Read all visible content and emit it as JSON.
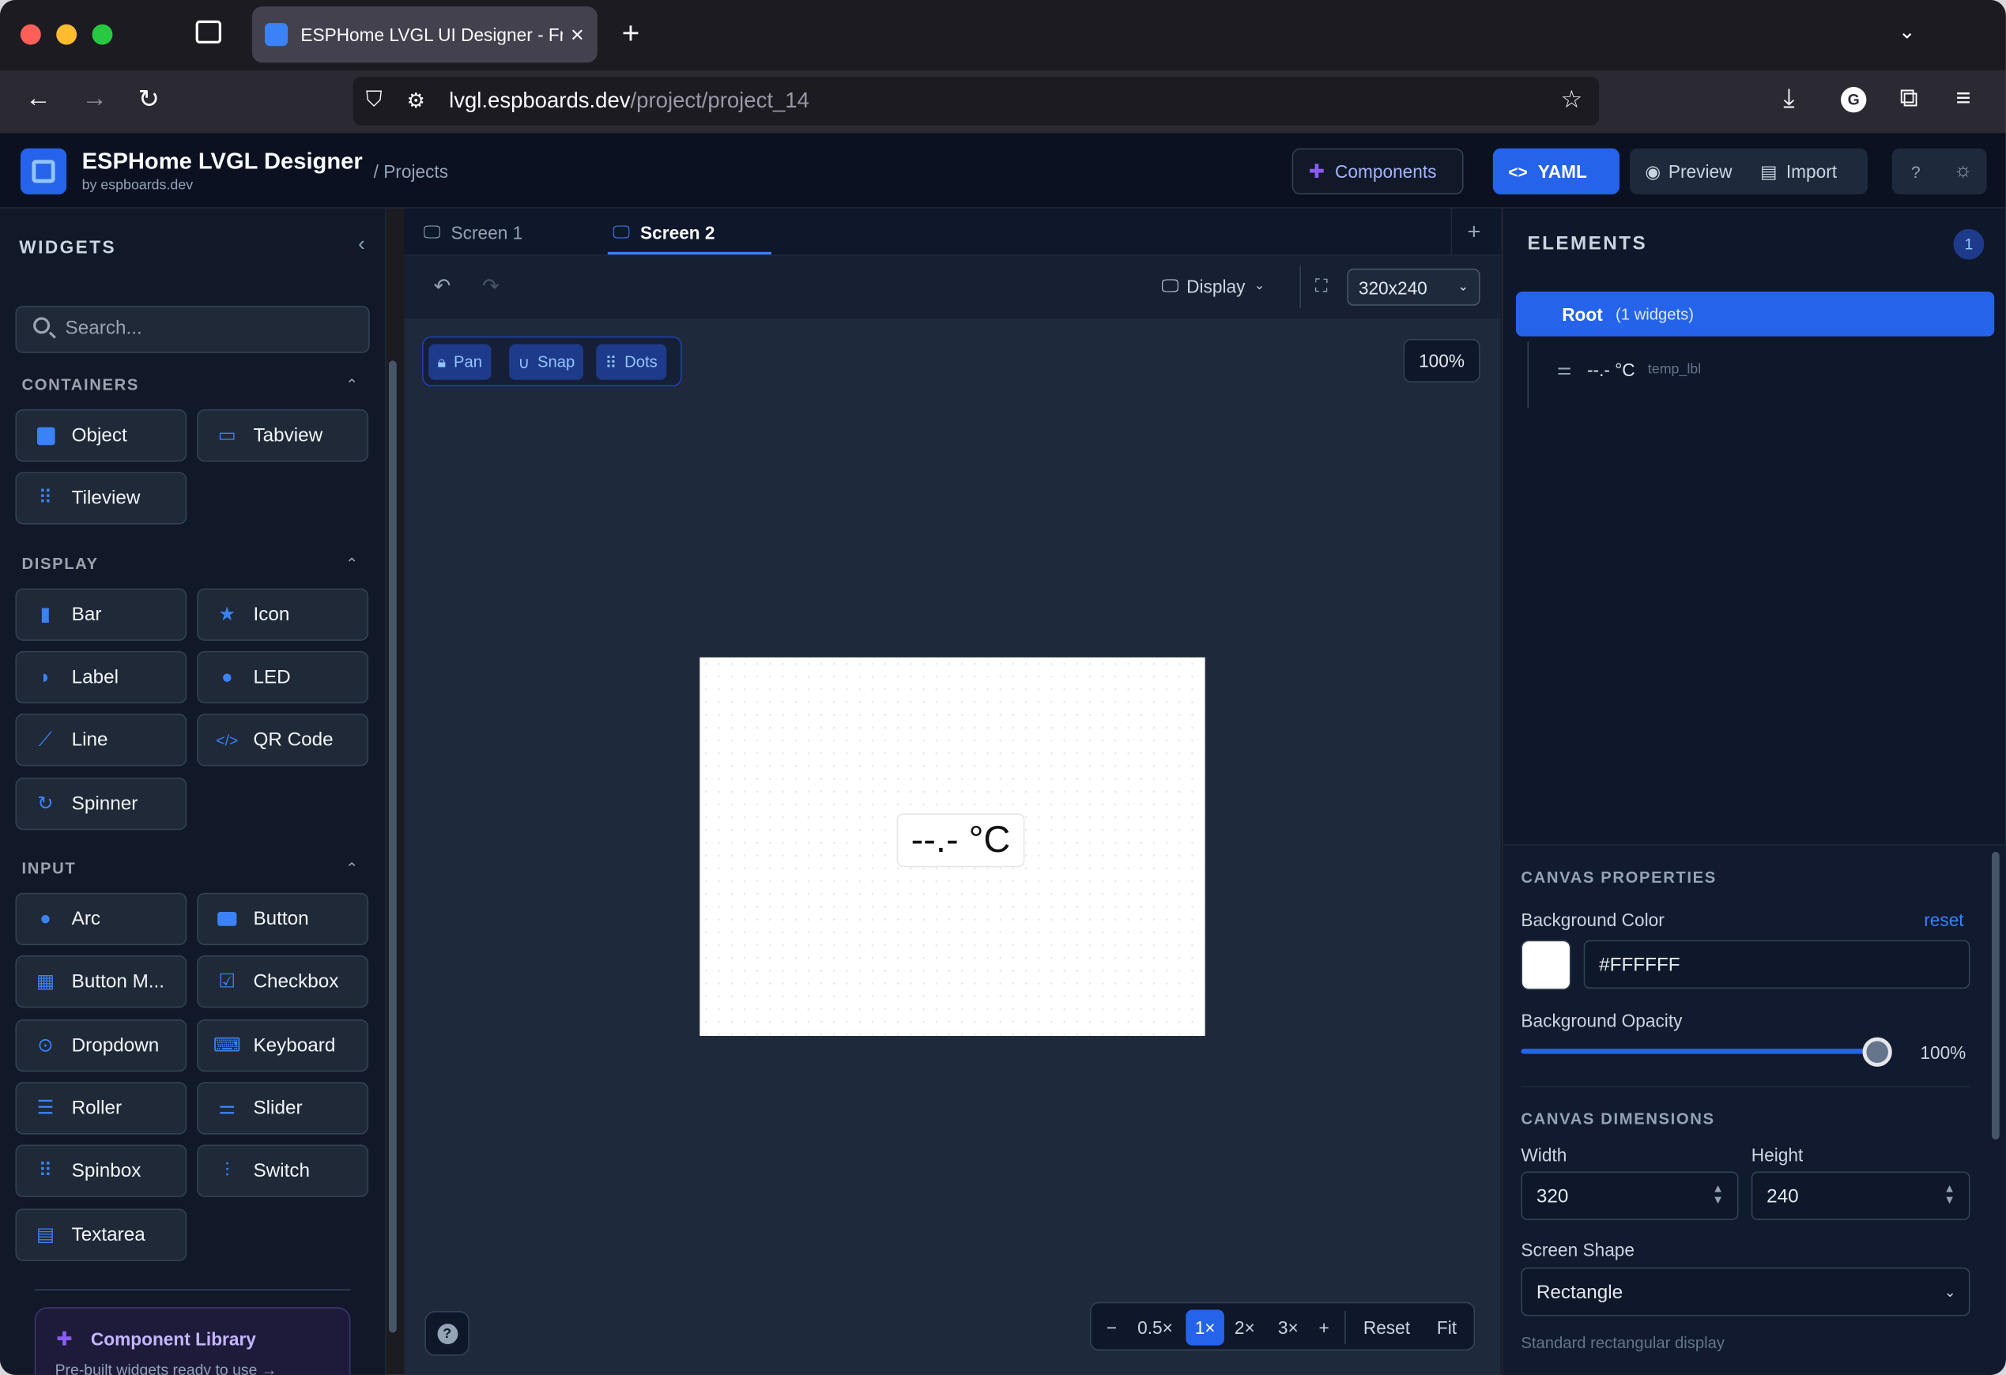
{
  "browser": {
    "tab_title": "ESPHome LVGL UI Designer - Fr",
    "url_host": "lvgl.espboards.dev",
    "url_path": "/project/project_14",
    "avatar_letter": "G"
  },
  "header": {
    "app_title": "ESPHome LVGL Designer",
    "app_subtitle": "by espboards.dev",
    "breadcrumb": "/ Projects",
    "components_label": "Components",
    "yaml_label": "YAML",
    "preview_label": "Preview",
    "import_label": "Import",
    "help_label": "?"
  },
  "sidebar": {
    "title": "WIDGETS",
    "search_placeholder": "Search...",
    "categories": [
      {
        "label": "CONTAINERS",
        "items": [
          "Object",
          "Tabview",
          "Tileview"
        ]
      },
      {
        "label": "DISPLAY",
        "items": [
          "Bar",
          "Icon",
          "Label",
          "LED",
          "Line",
          "QR Code",
          "Spinner"
        ]
      },
      {
        "label": "INPUT",
        "items": [
          "Arc",
          "Button",
          "Button M...",
          "Checkbox",
          "Dropdown",
          "Keyboard",
          "Roller",
          "Slider",
          "Spinbox",
          "Switch",
          "Textarea"
        ]
      }
    ],
    "library_title": "Component Library",
    "library_subtitle": "Pre-built widgets ready to use →"
  },
  "canvas": {
    "tabs": [
      "Screen 1",
      "Screen 2"
    ],
    "active_tab": "Screen 2",
    "display_label": "Display",
    "resolution": "320x240",
    "modes": [
      "Pan",
      "Snap",
      "Dots"
    ],
    "zoom_percent": "100%",
    "label_text": "--.- °C",
    "zoom_controls": [
      "−",
      "0.5×",
      "1×",
      "2×",
      "3×",
      "+",
      "Reset",
      "Fit"
    ],
    "active_zoom": "1×"
  },
  "elements": {
    "title": "ELEMENTS",
    "count": "1",
    "root_label": "Root",
    "root_meta": "(1 widgets)",
    "items": [
      {
        "text": "--.- °C",
        "id": "temp_lbl"
      }
    ]
  },
  "properties": {
    "section_canvas": "CANVAS PROPERTIES",
    "bg_color_label": "Background Color",
    "reset_label": "reset",
    "bg_color_value": "#FFFFFF",
    "bg_opacity_label": "Background Opacity",
    "bg_opacity_value": "100%",
    "bg_opacity": 1.0,
    "section_dimensions": "CANVAS DIMENSIONS",
    "width_label": "Width",
    "width_value": "320",
    "height_label": "Height",
    "height_value": "240",
    "shape_label": "Screen Shape",
    "shape_value": "Rectangle",
    "shape_hint": "Standard rectangular display"
  },
  "colors": {
    "accent": "#2563eb",
    "sidebar_bg": "#111827",
    "canvas_bg": "#1e293b"
  }
}
